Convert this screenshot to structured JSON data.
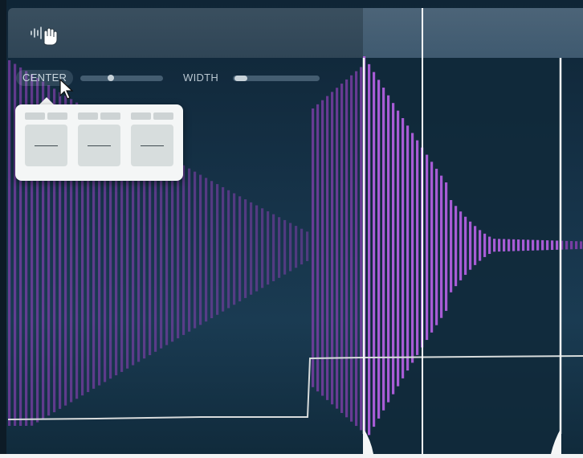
{
  "controls": {
    "center_label": "CENTER",
    "width_label": "WIDTH",
    "center_value": 0.35,
    "width_value": 0.05
  },
  "popup": {
    "presets": [
      {
        "value": "—"
      },
      {
        "value": "—"
      },
      {
        "value": "—"
      }
    ]
  },
  "colors": {
    "waveform": "#7d3fa8",
    "waveform_selected": "#b05fdd",
    "selection_bg": "#11293a",
    "envelope_line": "#d8dcdc",
    "playhead": "#ffffff"
  },
  "icons": {
    "toolbar": "grab-hand-icon",
    "cursor": "mouse-pointer-icon"
  }
}
